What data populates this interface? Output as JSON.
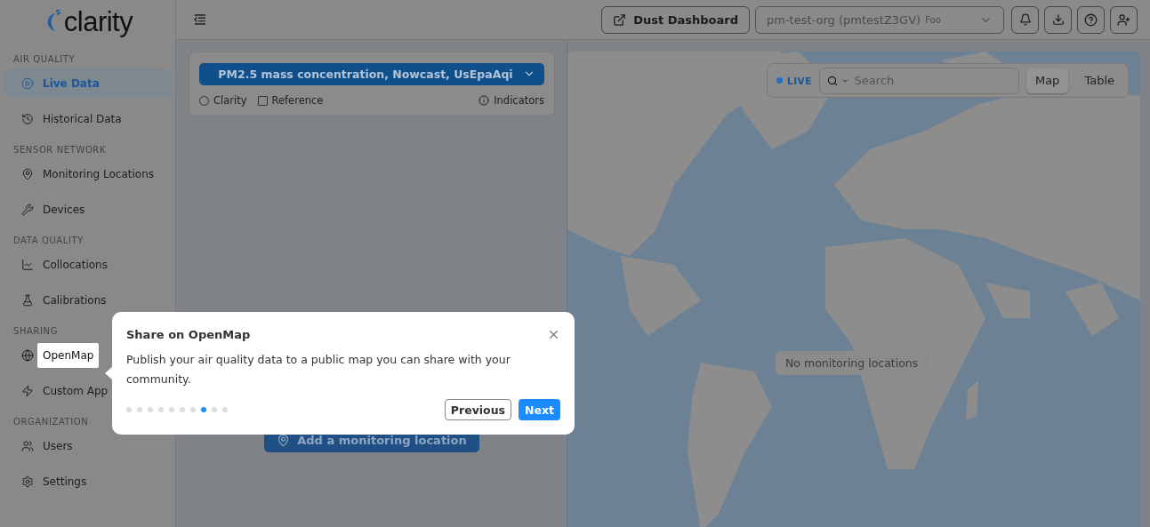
{
  "sidebar": {
    "logo": "clarity",
    "sections": [
      {
        "title": "AIR QUALITY",
        "items": [
          {
            "label": "Live Data",
            "selected": true,
            "spotlight": false
          },
          {
            "label": "Historical Data",
            "selected": false,
            "spotlight": false
          }
        ]
      },
      {
        "title": "SENSOR NETWORK",
        "items": [
          {
            "label": "Monitoring Locations",
            "selected": false,
            "spotlight": false
          },
          {
            "label": "Devices",
            "selected": false,
            "spotlight": false
          }
        ]
      },
      {
        "title": "DATA QUALITY",
        "items": [
          {
            "label": "Collocations",
            "selected": false,
            "spotlight": false
          },
          {
            "label": "Calibrations",
            "selected": false,
            "spotlight": false
          }
        ]
      },
      {
        "title": "SHARING",
        "items": [
          {
            "label": "OpenMap",
            "selected": false,
            "spotlight": true
          },
          {
            "label": "Custom App",
            "selected": false,
            "spotlight": false
          }
        ]
      },
      {
        "title": "ORGANIZATION",
        "items": [
          {
            "label": "Users",
            "selected": false,
            "spotlight": false
          },
          {
            "label": "Settings",
            "selected": false,
            "spotlight": false
          }
        ]
      }
    ]
  },
  "topbar": {
    "dashboard_button": "Dust Dashboard",
    "org_select": {
      "value": "pm-test-org (pmtestZ3GV)",
      "note": "Foo"
    }
  },
  "panel": {
    "metric_select": "PM2.5 mass concentration, Nowcast, UsEpaAqi",
    "options": [
      {
        "label": "Clarity",
        "kind": "radio",
        "checked": false
      },
      {
        "label": "Reference",
        "kind": "checkbox",
        "checked": false
      }
    ],
    "indicators": "Indicators",
    "add_button": "Add a monitoring location"
  },
  "map": {
    "live": "LIVE",
    "search": {
      "placeholder": "Search"
    },
    "view_tabs": [
      {
        "label": "Map",
        "selected": true
      },
      {
        "label": "Table",
        "selected": false
      }
    ],
    "empty_message": "No monitoring locations"
  },
  "tour": {
    "title": "Share on OpenMap",
    "body": "Publish your air quality data to a public map you can share with your community.",
    "steps": [
      {
        "selected": false
      },
      {
        "selected": false
      },
      {
        "selected": false
      },
      {
        "selected": false
      },
      {
        "selected": false
      },
      {
        "selected": false
      },
      {
        "selected": false
      },
      {
        "selected": true
      },
      {
        "selected": false
      },
      {
        "selected": false
      }
    ],
    "previous": "Previous",
    "next": "Next"
  }
}
